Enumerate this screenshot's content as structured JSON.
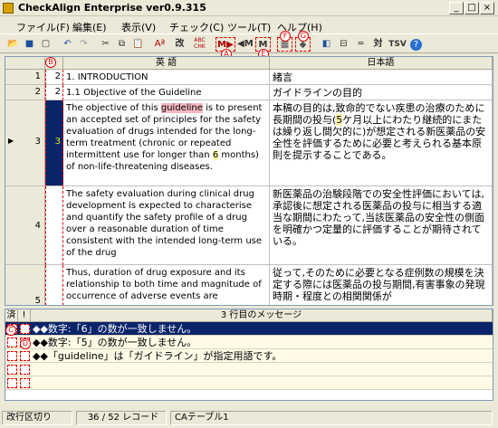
{
  "window": {
    "title": "CheckAlign Enterprise ver0.9.315",
    "min_label": "_",
    "max_label": "□",
    "close_label": "×"
  },
  "menu": [
    "ファイル(F)",
    "編集(E)",
    "表示(V)",
    "チェック(C)",
    "ツール(T)",
    "ヘルプ(H)"
  ],
  "toolbar": {
    "buttons": [
      "open",
      "save",
      "new",
      "undo",
      "redo",
      "cut",
      "copy",
      "paste",
      "font-size",
      "check-abc",
      "check-chk",
      "next-error",
      "prev-error",
      "prev-mark",
      "next-mark",
      "grid-1",
      "grid-2",
      "filter",
      "insert",
      "align",
      "split",
      "dict",
      "tsv",
      "help"
    ],
    "labels": {
      "aa": "Aª",
      "abc": "改",
      "chk": "ABC\nCHK",
      "next": "M▶",
      "prev": "◀M",
      "mark": "M",
      "tai": "対",
      "tsv": "TSV"
    }
  },
  "callouts": {
    "a": "A",
    "b": "B",
    "c": "C",
    "d": "D",
    "e": "E",
    "f": "F",
    "g": "G"
  },
  "grid": {
    "headers": {
      "src": "英 語",
      "tgt": "日本語"
    },
    "rows": [
      {
        "num": "1",
        "level": "2",
        "src": "1. INTRODUCTION",
        "tgt": "緒言"
      },
      {
        "num": "2",
        "level": "2",
        "src": "1.1 Objective of the Guideline",
        "tgt": "ガイドラインの目的"
      },
      {
        "num": "3",
        "level": "3",
        "src_before": "The objective of this ",
        "src_term": "guideline",
        "src_mid": " is to present an accepted set of principles for the safety evaluation of drugs intended for the long-term treatment (chronic or repeated intermittent use for longer than ",
        "src_num": "6",
        "src_after": " months) of non-life-threatening diseases.",
        "tgt_before": "本稿の目的は,致命的でない疾患の治療のために長期間の投与(",
        "tgt_num": "5",
        "tgt_after": "ケ月以上にわたり継続的にまたは繰り返し間欠的に)が想定される新医薬品の安全性を評価するために必要と考えられる基本原則を提示することである。"
      },
      {
        "num": "4",
        "level": "",
        "src": "The safety evaluation during clinical drug development is expected to characterise and quantify the safety profile of a drug over a reasonable duration of time consistent with the intended long-term use of the drug",
        "tgt": "新医薬品の治験段階での安全性評価においては,承認後に想定される医薬品の投与に相当する適当な期間にわたって,当該医薬品の安全性の側面を明確かつ定量的に評価することが期待されている。"
      },
      {
        "num": "5",
        "level": "",
        "src": "Thus, duration of drug exposure and its relationship to both time and magnitude of occurrence of adverse events are",
        "tgt": "従って,そのために必要となる症例数の規模を決定する際には医薬品の投与期間,有害事象の発現時期・程度との相関関係が"
      }
    ]
  },
  "messages": {
    "header": "3 行目のメッセージ",
    "col_a": "済",
    "col_b": "!",
    "items": [
      "◆◆数字:「6」の数が一致しません。",
      "◆◆数字:「5」の数が一致しません。",
      "◆◆「guideline」は「ガイドライン」が指定用語です。"
    ]
  },
  "status": {
    "mode": "改行区切り",
    "records": "36 / 52 レコード",
    "table": "CAテーブル1"
  },
  "colors": {
    "accent": "#0a246a",
    "highlight_pink": "#f5b7c0",
    "highlight_yellow": "#fff5a8",
    "annotation_red": "#e00000"
  }
}
